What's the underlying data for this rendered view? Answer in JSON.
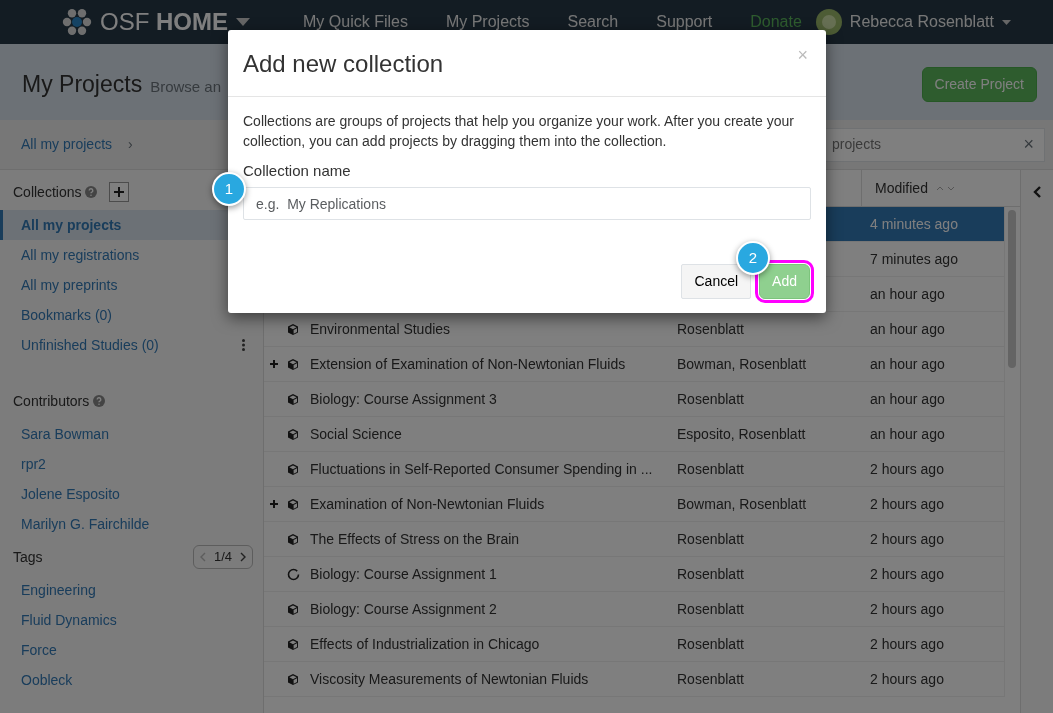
{
  "navbar": {
    "brand": "OSF **HOME**",
    "links": [
      {
        "label": "My Quick Files",
        "kind": "link"
      },
      {
        "label": "My Projects",
        "kind": "link"
      },
      {
        "label": "Search",
        "kind": "link"
      },
      {
        "label": "Support",
        "kind": "link"
      },
      {
        "label": "Donate",
        "kind": "donate"
      }
    ],
    "user": "Rebecca Rosenblatt"
  },
  "header": {
    "title": "My Projects",
    "subtitle": "Browse an",
    "create_button": "Create Project"
  },
  "breadcrumb": {
    "label": "All my projects",
    "separator": "›",
    "search_placeholder": "projects",
    "clear": "×"
  },
  "sidebar": {
    "collections_title": "Collections",
    "collections": [
      {
        "label": "All my projects",
        "selected": true
      },
      {
        "label": "All my registrations",
        "selected": false
      },
      {
        "label": "All my preprints",
        "selected": false
      },
      {
        "label": "Bookmarks (0)",
        "selected": false
      },
      {
        "label": "Unfinished Studies (0)",
        "selected": false,
        "menu": true
      }
    ],
    "contributors_title": "Contributors",
    "contributors": [
      "Sara Bowman",
      "rpr2",
      "Jolene Esposito",
      "Marilyn G. Fairchilde"
    ],
    "tags_title": "Tags",
    "tags_pager": "1/4",
    "tags": [
      "Engineering",
      "Fluid Dynamics",
      "Force",
      "Oobleck"
    ]
  },
  "table": {
    "columns": [
      {
        "label": "Modified"
      }
    ],
    "rows": [
      {
        "modified": "4 minutes ago",
        "selected": true
      },
      {
        "modified": "7 minutes ago",
        "selected": false
      },
      {
        "modified": "an hour ago",
        "selected": false
      },
      {
        "kind": "cube",
        "expandable": false,
        "name": "Environmental Studies",
        "contributors": "Rosenblatt",
        "modified": "an hour ago",
        "selected": false
      },
      {
        "kind": "cube",
        "expandable": true,
        "name": "Extension of Examination of Non-Newtonian Fluids",
        "contributors": "Bowman, Rosenblatt",
        "modified": "an hour ago",
        "selected": false
      },
      {
        "kind": "cube",
        "expandable": false,
        "name": "Biology: Course Assignment 3",
        "contributors": "Rosenblatt",
        "modified": "an hour ago",
        "selected": false
      },
      {
        "kind": "cube",
        "expandable": false,
        "name": "Social Science",
        "contributors": "Esposito, Rosenblatt",
        "modified": "an hour ago",
        "selected": false
      },
      {
        "kind": "cube",
        "expandable": false,
        "name": "Fluctuations in Self-Reported Consumer Spending in ...",
        "contributors": "Rosenblatt",
        "modified": "2 hours ago",
        "selected": false
      },
      {
        "kind": "cube",
        "expandable": true,
        "name": "Examination of Non-Newtonian Fluids",
        "contributors": "Bowman, Rosenblatt",
        "modified": "2 hours ago",
        "selected": false
      },
      {
        "kind": "cube",
        "expandable": false,
        "name": "The Effects of Stress on the Brain",
        "contributors": "Rosenblatt",
        "modified": "2 hours ago",
        "selected": false
      },
      {
        "kind": "spinner",
        "expandable": false,
        "name": "Biology: Course Assignment 1",
        "contributors": "Rosenblatt",
        "modified": "2 hours ago",
        "selected": false
      },
      {
        "kind": "cube",
        "expandable": false,
        "name": "Biology: Course Assignment 2",
        "contributors": "Rosenblatt",
        "modified": "2 hours ago",
        "selected": false
      },
      {
        "kind": "cube",
        "expandable": false,
        "name": "Effects of Industrialization in Chicago",
        "contributors": "Rosenblatt",
        "modified": "2 hours ago",
        "selected": false
      },
      {
        "kind": "cube",
        "expandable": false,
        "name": "Viscosity Measurements of Newtonian Fluids",
        "contributors": "Rosenblatt",
        "modified": "2 hours ago",
        "selected": false
      }
    ]
  },
  "modal": {
    "title": "Add new collection",
    "close": "×",
    "text": "Collections are groups of projects that help you organize your work. After you create your collection, you can add projects by dragging them into the collection.",
    "field_label": "Collection name",
    "placeholder": "e.g.  My Replications",
    "cancel_button": "Cancel",
    "add_button": {
      "label": "Add",
      "highlighted": true
    },
    "callouts": [
      "1",
      "2"
    ]
  }
}
